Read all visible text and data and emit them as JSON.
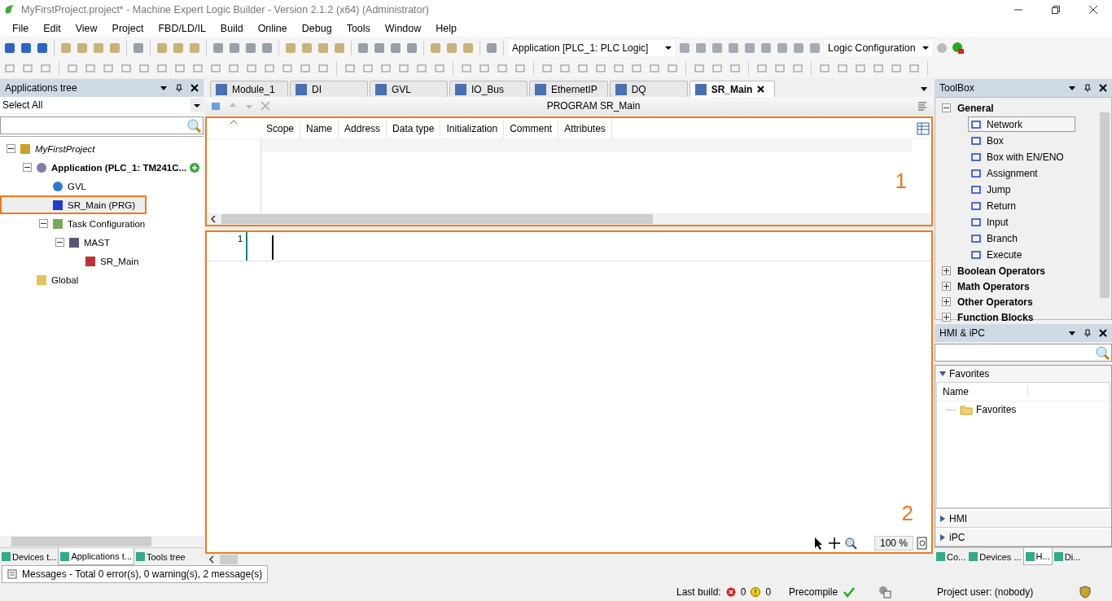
{
  "window": {
    "title": "MyFirstProject.project* - Machine Expert Logic Builder - Version 2.1.2 (x64) (Administrator)"
  },
  "menu": [
    "File",
    "Edit",
    "View",
    "Project",
    "FBD/LD/IL",
    "Build",
    "Online",
    "Debug",
    "Tools",
    "Window",
    "Help"
  ],
  "toolbar": {
    "application": "Application [PLC_1: PLC Logic]",
    "configuration": "Logic Configuration"
  },
  "applications_tree": {
    "title": "Applications tree",
    "filter": "Select All",
    "tree": [
      {
        "label": "MyFirstProject",
        "kind": "project",
        "expanded": true,
        "selected": false,
        "children": [
          {
            "label": "Application (PLC_1: TM241C...",
            "kind": "application",
            "expanded": true,
            "selected": false,
            "children": [
              {
                "label": "GVL",
                "kind": "gvl",
                "selected": false
              },
              {
                "label": "SR_Main (PRG)",
                "kind": "program",
                "selected": true
              },
              {
                "label": "Task Configuration",
                "kind": "task-config",
                "expanded": true,
                "selected": false,
                "children": [
                  {
                    "label": "MAST",
                    "kind": "task",
                    "expanded": true,
                    "selected": false,
                    "children": [
                      {
                        "label": "SR_Main",
                        "kind": "call",
                        "selected": false
                      }
                    ]
                  }
                ]
              }
            ]
          },
          {
            "label": "Global",
            "kind": "folder",
            "selected": false
          }
        ]
      }
    ]
  },
  "left_tabs": [
    {
      "label": "Devices t...",
      "selected": false
    },
    {
      "label": "Applications t...",
      "selected": true
    },
    {
      "label": "Tools tree",
      "selected": false
    }
  ],
  "editor_tabs": [
    {
      "label": "Module_1",
      "selected": false
    },
    {
      "label": "DI",
      "selected": false
    },
    {
      "label": "GVL",
      "selected": false
    },
    {
      "label": "IO_Bus",
      "selected": false
    },
    {
      "label": "EthernetIP",
      "selected": false
    },
    {
      "label": "DQ",
      "selected": false
    },
    {
      "label": "SR_Main",
      "selected": true
    }
  ],
  "declaration": {
    "header": "PROGRAM SR_Main",
    "columns": [
      "Scope",
      "Name",
      "Address",
      "Data type",
      "Initialization",
      "Comment",
      "Attributes"
    ],
    "marker": "1"
  },
  "code": {
    "line_number": "1",
    "marker": "2",
    "zoom": "100 %"
  },
  "toolbox": {
    "title": "ToolBox",
    "groups": [
      {
        "label": "General",
        "expanded": true,
        "items": [
          {
            "label": "Network",
            "selected": true
          },
          {
            "label": "Box",
            "selected": false
          },
          {
            "label": "Box with EN/ENO",
            "selected": false
          },
          {
            "label": "Assignment",
            "selected": false
          },
          {
            "label": "Jump",
            "selected": false
          },
          {
            "label": "Return",
            "selected": false
          },
          {
            "label": "Input",
            "selected": false
          },
          {
            "label": "Branch",
            "selected": false
          },
          {
            "label": "Execute",
            "selected": false
          }
        ]
      },
      {
        "label": "Boolean Operators",
        "expanded": false
      },
      {
        "label": "Math Operators",
        "expanded": false
      },
      {
        "label": "Other Operators",
        "expanded": false
      },
      {
        "label": "Function Blocks",
        "expanded": false
      }
    ]
  },
  "hmi_panel": {
    "title": "HMI & iPC",
    "sections": [
      {
        "label": "Favorites",
        "expanded": true,
        "column": "Name",
        "items": [
          "Favorites"
        ]
      },
      {
        "label": "HMI",
        "expanded": false
      },
      {
        "label": "iPC",
        "expanded": false
      }
    ]
  },
  "right_tabs": [
    {
      "label": "Co...",
      "selected": false
    },
    {
      "label": "Devices ...",
      "selected": false
    },
    {
      "label": "H...",
      "selected": true
    },
    {
      "label": "Di...",
      "selected": false
    }
  ],
  "messages": "Messages - Total 0 error(s), 0 warning(s), 2 message(s)",
  "status_bar": {
    "last_build": "Last build:",
    "errors": "0",
    "warnings": "0",
    "precompile": "Precompile",
    "user": "Project user: (nobody)"
  }
}
